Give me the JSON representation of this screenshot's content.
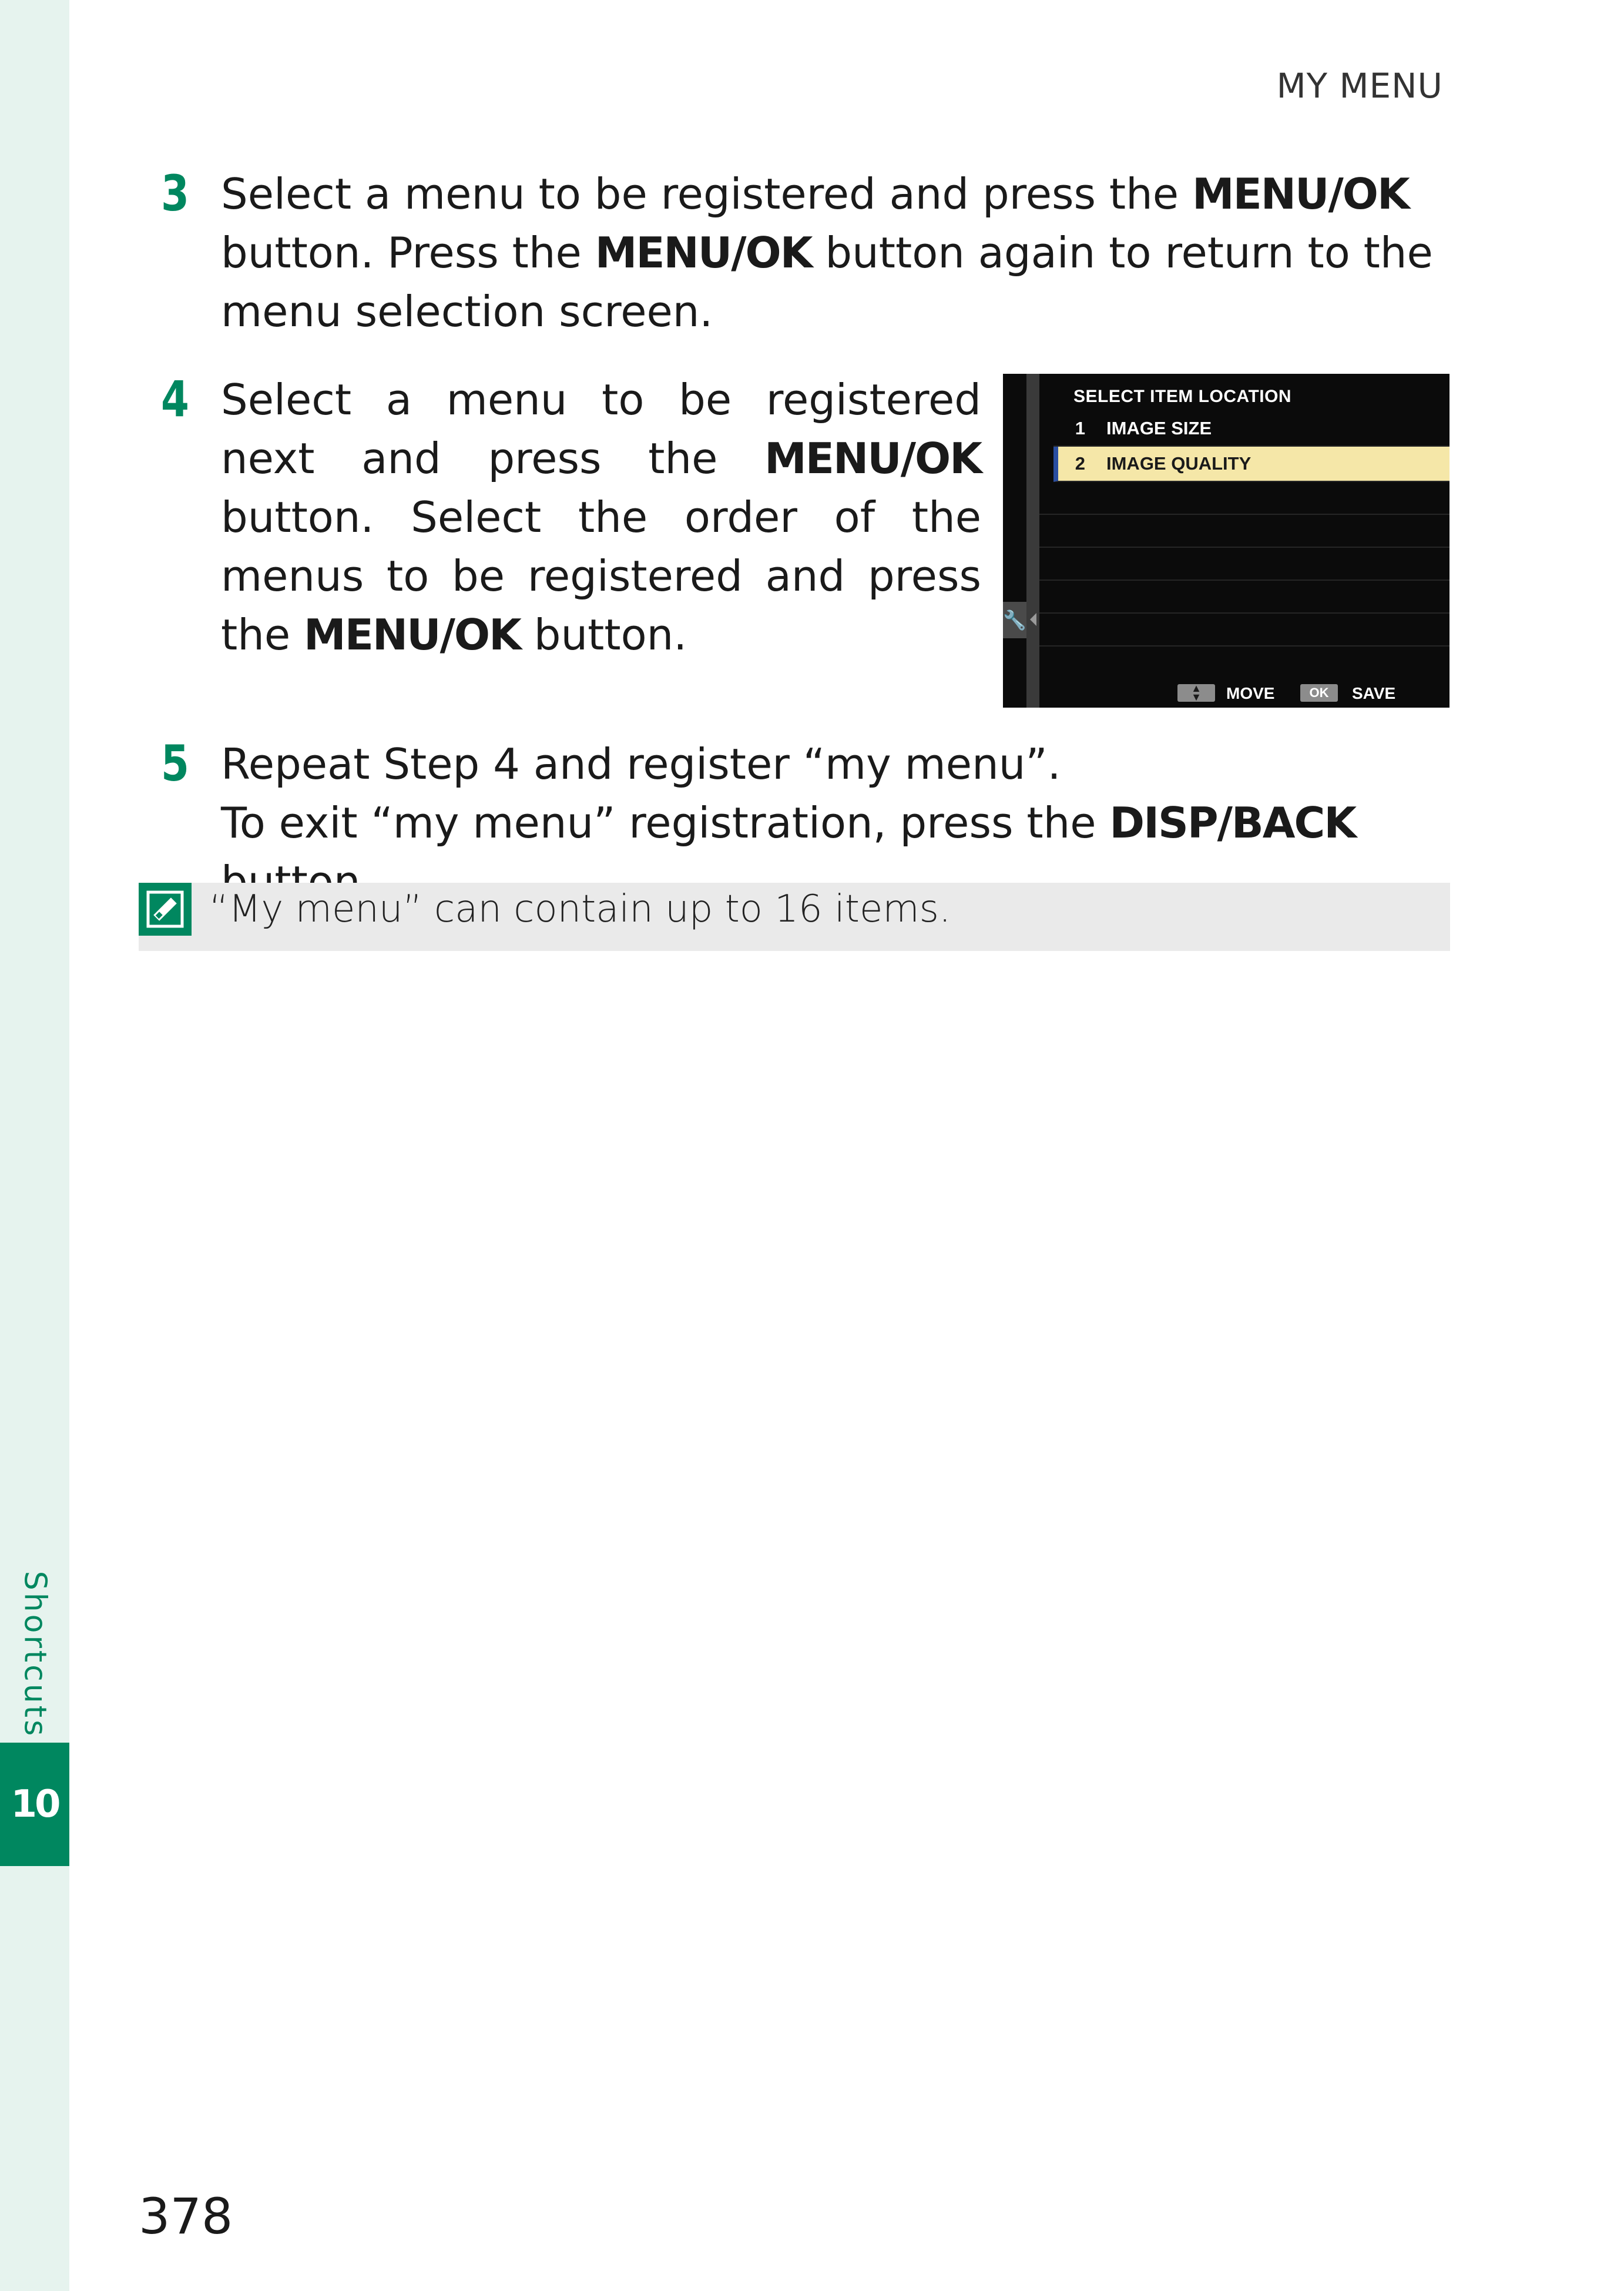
{
  "header": {
    "section": "MY MENU"
  },
  "sidebar": {
    "label": "Shortcuts",
    "chapter": "10"
  },
  "steps": [
    {
      "num": "3",
      "parts": [
        "Select a menu to be registered and press the ",
        "MENU/OK",
        " button. Press the ",
        "MENU/OK",
        " button again to return to the menu selec­tion screen."
      ]
    },
    {
      "num": "4",
      "parts": [
        "Select a menu to be registered next and press the ",
        "MENU/OK",
        " button. Select the order of the menus to be regis­tered and press the ",
        "MENU/OK",
        " button."
      ]
    },
    {
      "num": "5",
      "parts": [
        "Repeat Step 4 and register “my menu”.",
        "To exit “my menu” registration, press the ",
        "DISP/BACK",
        " button."
      ]
    }
  ],
  "camera_screen": {
    "title": "SELECT ITEM LOCATION",
    "items": [
      {
        "no": "1",
        "label": "IMAGE SIZE"
      },
      {
        "no": "2",
        "label": "IMAGE QUALITY"
      }
    ],
    "footer": {
      "move": "MOVE",
      "ok": "OK",
      "save": "SAVE"
    },
    "highlight_color": "#f5e7a8"
  },
  "note": {
    "icon": "memo-icon",
    "text": "“My menu” can contain up to 16 items."
  },
  "page_number": "378",
  "colors": {
    "accent": "#00875f",
    "sidebar_bg": "#e6f3ee",
    "note_bg": "#eaeaea"
  }
}
